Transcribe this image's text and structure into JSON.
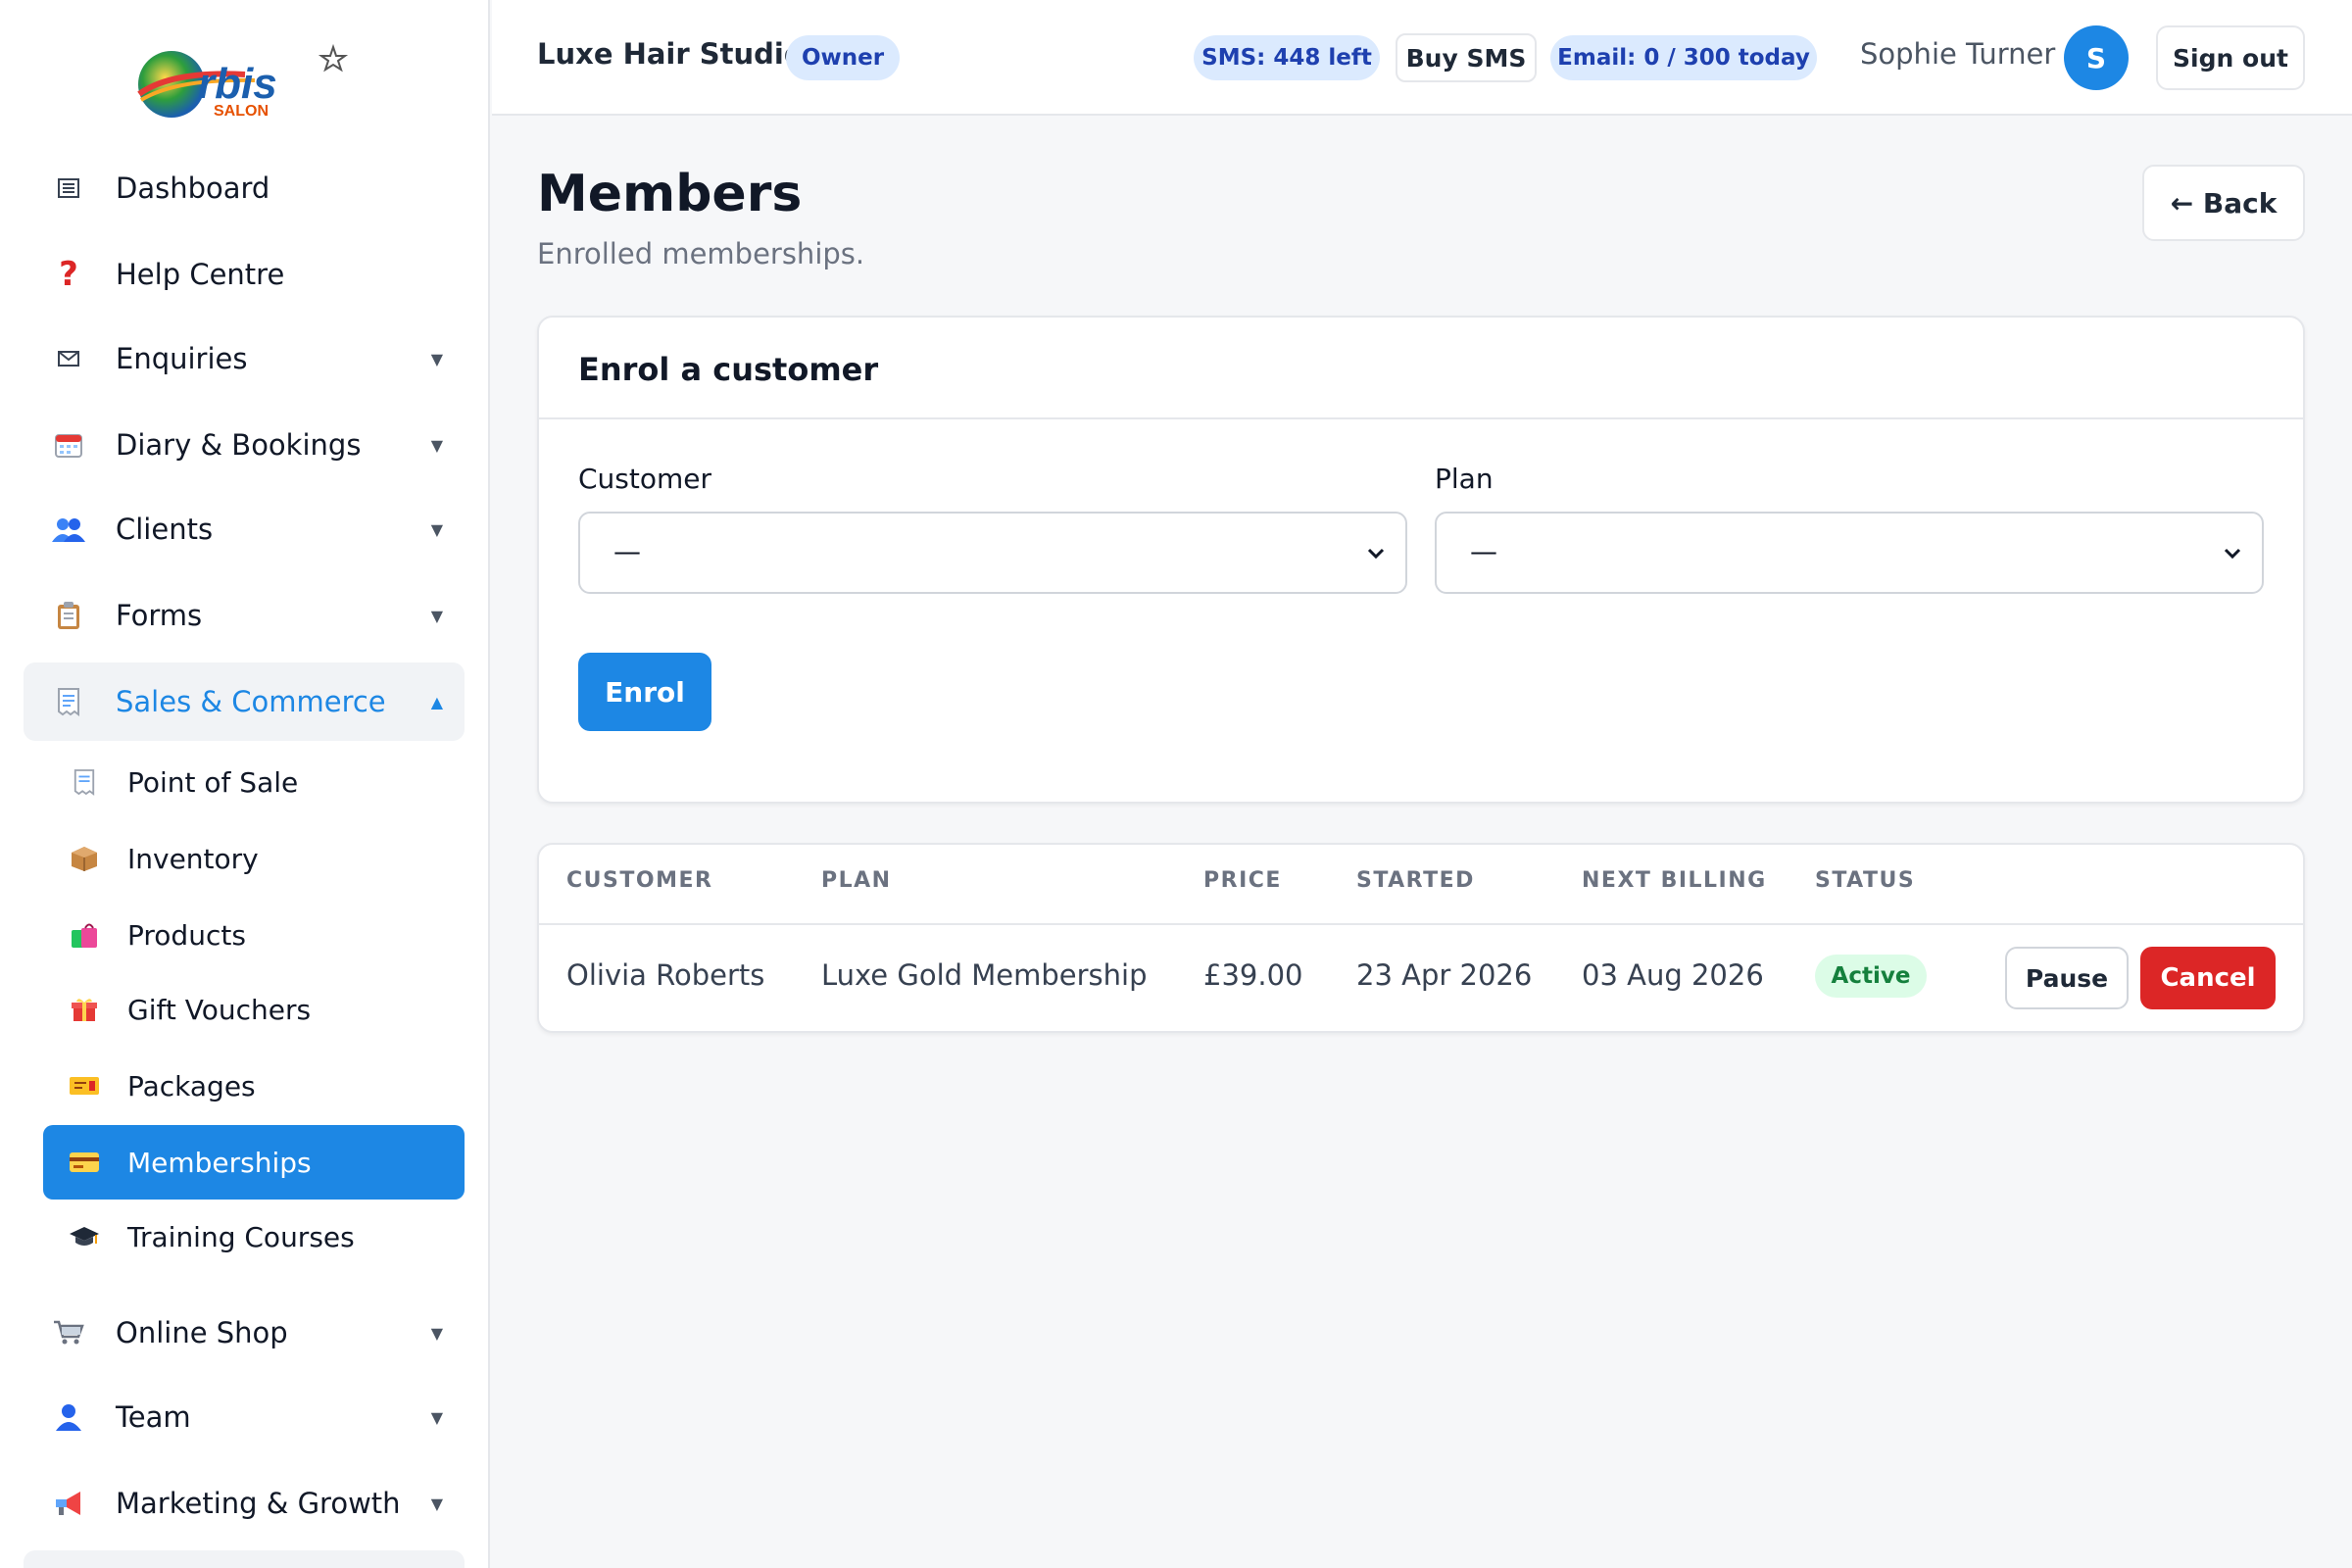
{
  "brand": {
    "logo_text": "rbis",
    "logo_sub": "SALON"
  },
  "sidebar": {
    "items": [
      {
        "label": "Dashboard",
        "icon": "dashboard-icon"
      },
      {
        "label": "Help Centre",
        "icon": "question-icon"
      },
      {
        "label": "Enquiries",
        "icon": "envelope-icon"
      },
      {
        "label": "Diary & Bookings",
        "icon": "calendar-icon"
      },
      {
        "label": "Clients",
        "icon": "people-icon"
      },
      {
        "label": "Forms",
        "icon": "clipboard-icon"
      },
      {
        "label": "Sales & Commerce",
        "icon": "receipt-icon"
      },
      {
        "label": "Online Shop",
        "icon": "cart-icon"
      },
      {
        "label": "Team",
        "icon": "person-icon"
      },
      {
        "label": "Marketing & Growth",
        "icon": "megaphone-icon"
      }
    ],
    "sub_items": [
      {
        "label": "Point of Sale",
        "icon": "receipt-icon"
      },
      {
        "label": "Inventory",
        "icon": "box-icon"
      },
      {
        "label": "Products",
        "icon": "shopping-bags-icon"
      },
      {
        "label": "Gift Vouchers",
        "icon": "gift-icon"
      },
      {
        "label": "Packages",
        "icon": "ticket-icon"
      },
      {
        "label": "Memberships",
        "icon": "credit-card-icon"
      },
      {
        "label": "Training Courses",
        "icon": "graduation-cap-icon"
      }
    ]
  },
  "topbar": {
    "studio_name": "Luxe Hair Studio",
    "role_badge": "Owner",
    "sms_left": "SMS: 448 left",
    "buy_sms": "Buy SMS",
    "email_quota": "Email: 0 / 300 today",
    "user_name": "Sophie Turner",
    "avatar_initial": "S",
    "sign_out": "Sign out"
  },
  "page": {
    "title": "Members",
    "subtitle": "Enrolled memberships.",
    "back_label": "← Back"
  },
  "enrol": {
    "title": "Enrol a customer",
    "customer_label": "Customer",
    "customer_value": "—",
    "plan_label": "Plan",
    "plan_value": "—",
    "submit_label": "Enrol"
  },
  "table": {
    "headers": [
      "CUSTOMER",
      "PLAN",
      "PRICE",
      "STARTED",
      "NEXT BILLING",
      "STATUS"
    ],
    "rows": [
      {
        "customer": "Olivia Roberts",
        "plan": "Luxe Gold Membership",
        "price": "£39.00",
        "started": "23 Apr 2026",
        "next_billing": "03 Aug 2026",
        "status": "Active",
        "pause_label": "Pause",
        "cancel_label": "Cancel"
      }
    ]
  },
  "colors": {
    "accent": "#1d87e4",
    "danger": "#dc2626",
    "success_bg": "#dcfce7",
    "success_text": "#15803d"
  }
}
